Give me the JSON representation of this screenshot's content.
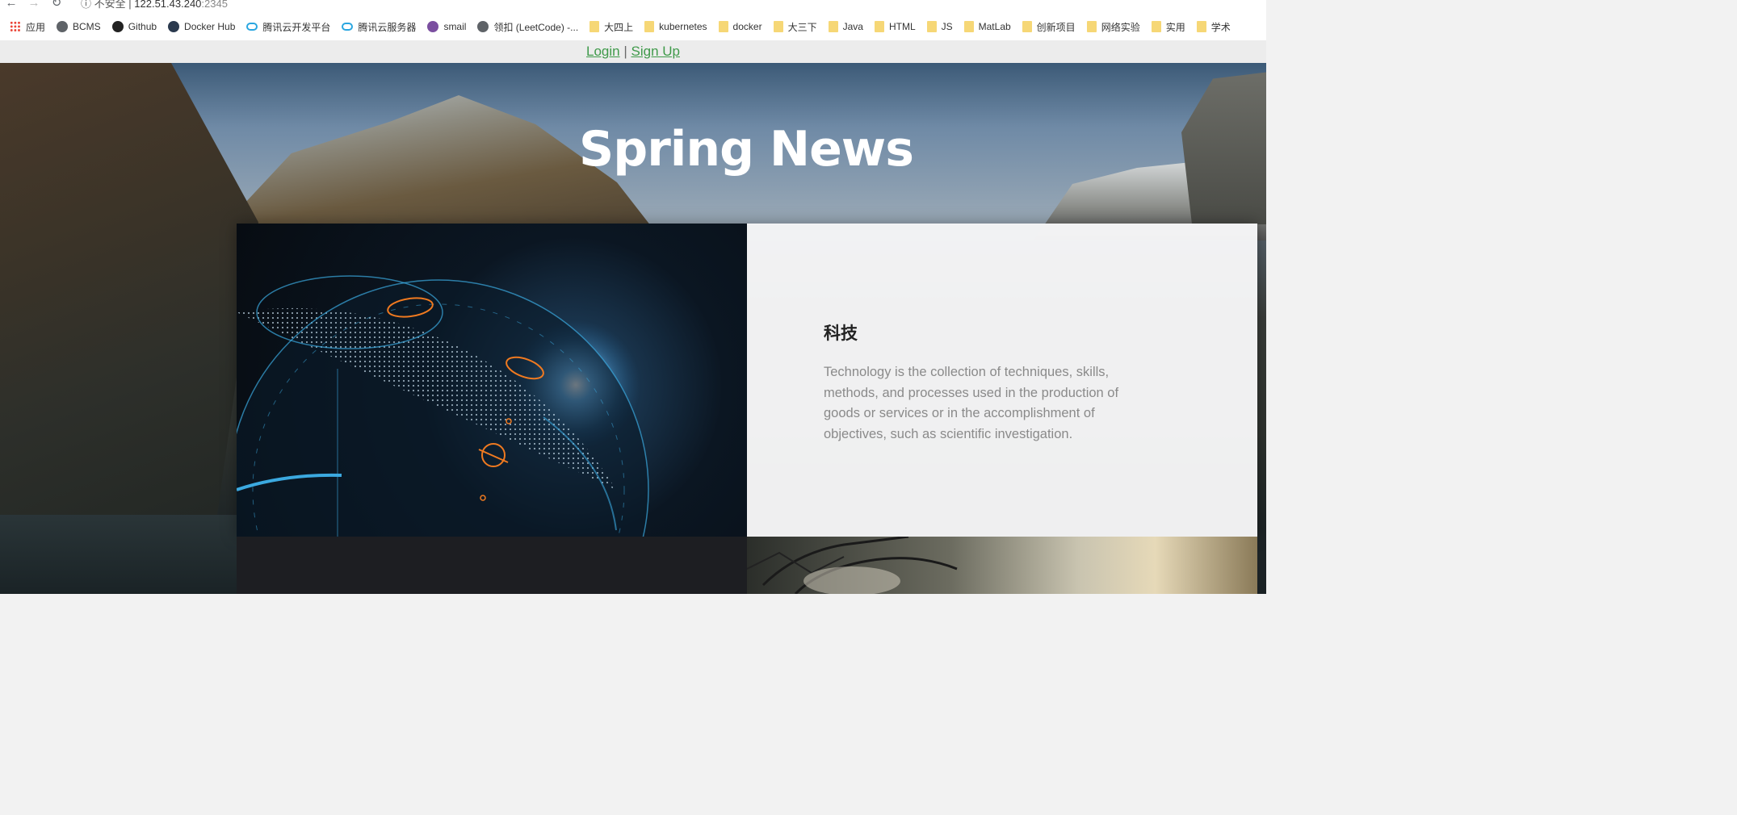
{
  "browser": {
    "address": {
      "security_label": "不安全 |",
      "host": "122.51.43.240",
      "port": ":2345"
    },
    "bookmarks": [
      {
        "label": "应用",
        "icon": "apps-grid-icon"
      },
      {
        "label": "BCMS",
        "icon": "globe-icon"
      },
      {
        "label": "Github",
        "icon": "github-icon"
      },
      {
        "label": "Docker Hub",
        "icon": "docker-icon"
      },
      {
        "label": "腾讯云开发平台",
        "icon": "tencent-cloud-icon"
      },
      {
        "label": "腾讯云服务器",
        "icon": "tencent-cloud-icon"
      },
      {
        "label": "smail",
        "icon": "smail-icon"
      },
      {
        "label": "领扣 (LeetCode) -...",
        "icon": "globe-icon"
      },
      {
        "label": "大四上",
        "icon": "folder-icon"
      },
      {
        "label": "kubernetes",
        "icon": "folder-icon"
      },
      {
        "label": "docker",
        "icon": "folder-icon"
      },
      {
        "label": "大三下",
        "icon": "folder-icon"
      },
      {
        "label": "Java",
        "icon": "folder-icon"
      },
      {
        "label": "HTML",
        "icon": "folder-icon"
      },
      {
        "label": "JS",
        "icon": "folder-icon"
      },
      {
        "label": "MatLab",
        "icon": "folder-icon"
      },
      {
        "label": "创新项目",
        "icon": "folder-icon"
      },
      {
        "label": "网络实验",
        "icon": "folder-icon"
      },
      {
        "label": "实用",
        "icon": "folder-icon"
      },
      {
        "label": "学术",
        "icon": "folder-icon"
      }
    ]
  },
  "auth": {
    "login_label": "Login",
    "separator": "|",
    "signup_label": "Sign Up"
  },
  "hero": {
    "title": "Spring News"
  },
  "card": {
    "heading": "科技",
    "description": "Technology is the collection of techniques, skills, methods, and processes used in the production of goods or services or in the accomplishment of objectives, such as scientific investigation."
  },
  "colors": {
    "link": "#3f9a4a",
    "title": "#ffffff",
    "card_text": "#8a8a8a",
    "globe_line": "#3ba9e0",
    "globe_marker": "#f07a20"
  }
}
